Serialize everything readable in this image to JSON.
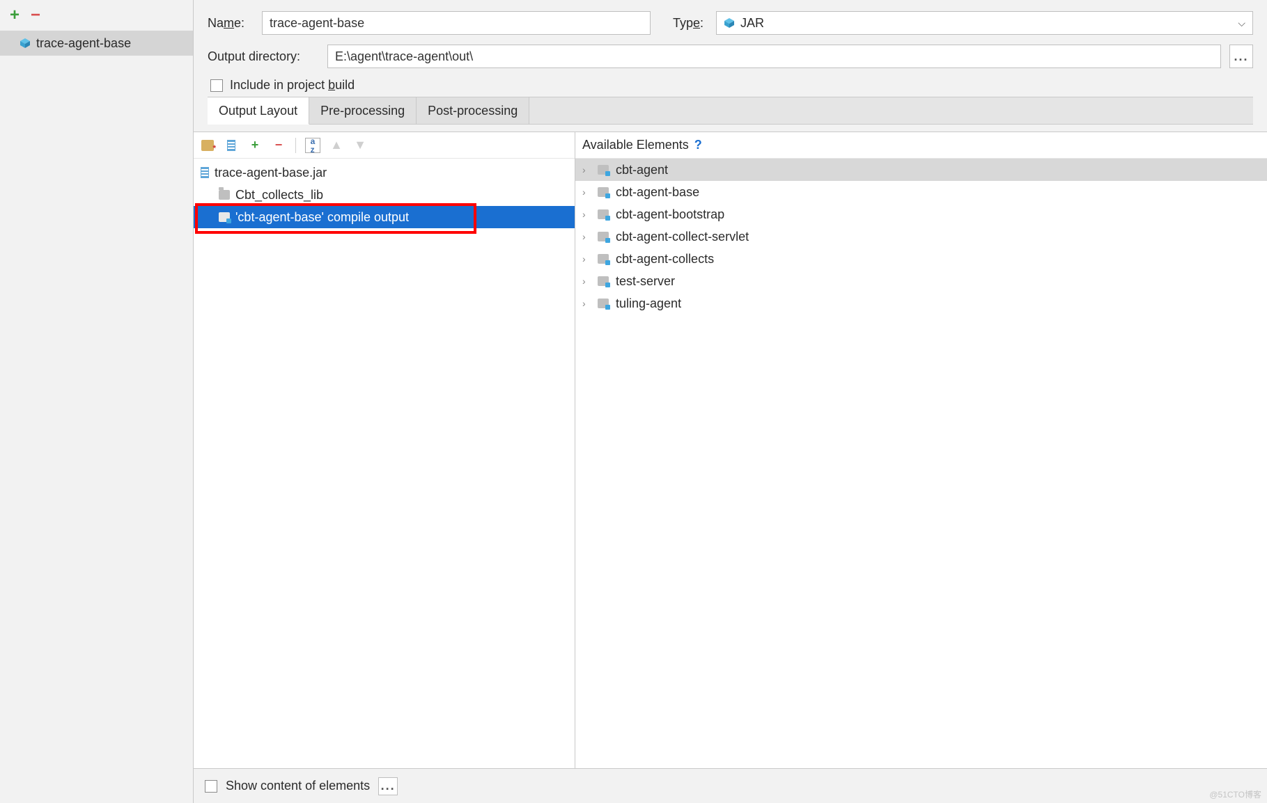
{
  "sidebar": {
    "artifact_label": "trace-agent-base"
  },
  "form": {
    "name_label": "Name:",
    "name_value": "trace-agent-base",
    "type_label": "Type:",
    "type_value": "JAR",
    "outdir_label": "Output directory:",
    "outdir_value": "E:\\agent\\trace-agent\\out\\",
    "browse_ellipsis": "...",
    "include_label": "Include in project build"
  },
  "tabs": {
    "output_layout": "Output Layout",
    "pre_processing": "Pre-processing",
    "post_processing": "Post-processing"
  },
  "tree": {
    "root": "trace-agent-base.jar",
    "child_folder": "Cbt_collects_lib",
    "child_compile": "'cbt-agent-base' compile output"
  },
  "available": {
    "header": "Available Elements",
    "help": "?",
    "items": [
      "cbt-agent",
      "cbt-agent-base",
      "cbt-agent-bootstrap",
      "cbt-agent-collect-servlet",
      "cbt-agent-collects",
      "test-server",
      "tuling-agent"
    ]
  },
  "bottom": {
    "show_content_label": "Show content of elements",
    "ellipsis": "..."
  },
  "watermark": "@51CTO博客"
}
